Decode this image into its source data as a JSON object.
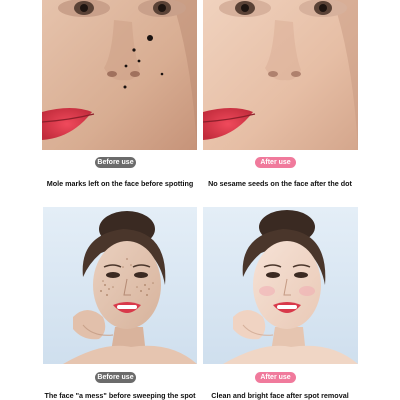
{
  "panels": [
    {
      "badge": "Before use",
      "badge_color": "#6b6b6b",
      "caption": "Mole marks left on the face before spotting"
    },
    {
      "badge": "After use",
      "badge_color": "#f07a9c",
      "caption": "No sesame seeds on the face after the dot"
    },
    {
      "badge": "Before use",
      "badge_color": "#6b6b6b",
      "caption": "The face \"a mess\" before sweeping the spot"
    },
    {
      "badge": "After use",
      "badge_color": "#f07a9c",
      "caption": "Clean and bright face after spot removal"
    }
  ],
  "colors": {
    "skin": "#d9b49c",
    "lips": "#d8394a",
    "hair": "#3a2a22",
    "studio_background": "#dde9f4"
  }
}
